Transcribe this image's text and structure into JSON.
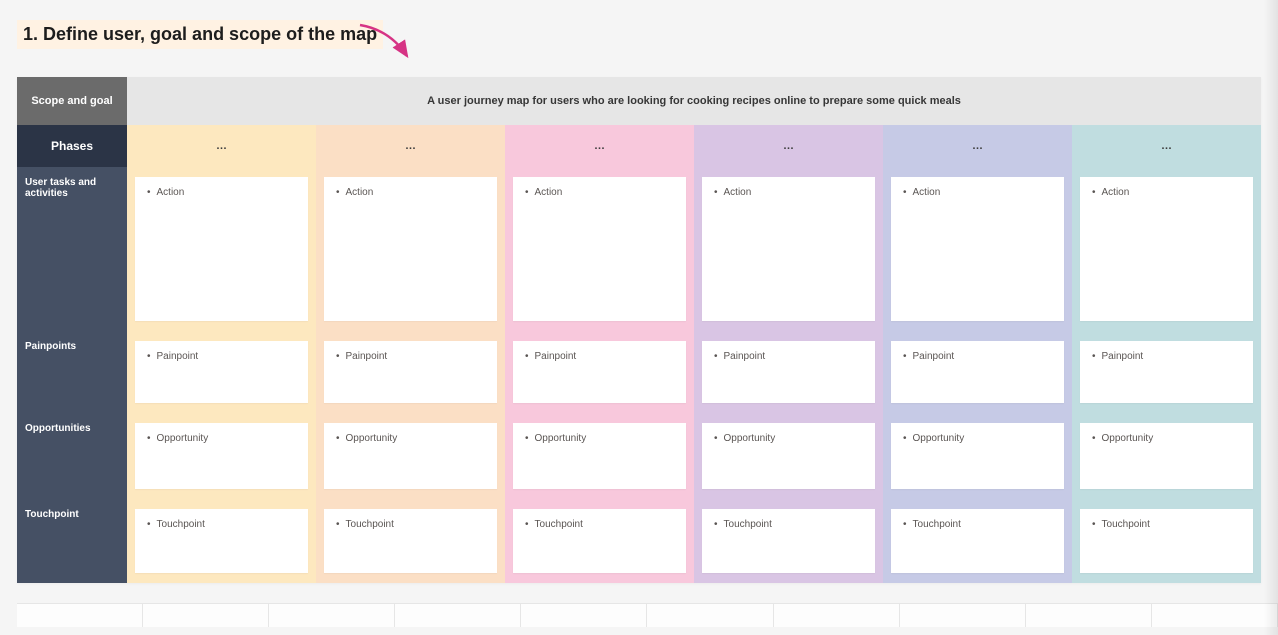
{
  "title": "1. Define user, goal and scope of the map",
  "scope": {
    "label": "Scope and goal",
    "text": "A user journey map for users who are looking for cooking recipes online to prepare some quick meals"
  },
  "headers": {
    "phases": "Phases",
    "tasks": "User tasks and activities",
    "painpoints": "Painpoints",
    "opportunities": "Opportunities",
    "touchpoint": "Touchpoint"
  },
  "columns": [
    {
      "phase": "…",
      "action": "Action",
      "painpoint": "Painpoint",
      "opportunity": "Opportunity",
      "touchpoint": "Touchpoint"
    },
    {
      "phase": "…",
      "action": "Action",
      "painpoint": "Painpoint",
      "opportunity": "Opportunity",
      "touchpoint": "Touchpoint"
    },
    {
      "phase": "…",
      "action": "Action",
      "painpoint": "Painpoint",
      "opportunity": "Opportunity",
      "touchpoint": "Touchpoint"
    },
    {
      "phase": "…",
      "action": "Action",
      "painpoint": "Painpoint",
      "opportunity": "Opportunity",
      "touchpoint": "Touchpoint"
    },
    {
      "phase": "…",
      "action": "Action",
      "painpoint": "Painpoint",
      "opportunity": "Opportunity",
      "touchpoint": "Touchpoint"
    },
    {
      "phase": "…",
      "action": "Action",
      "painpoint": "Painpoint",
      "opportunity": "Opportunity",
      "touchpoint": "Touchpoint"
    }
  ]
}
